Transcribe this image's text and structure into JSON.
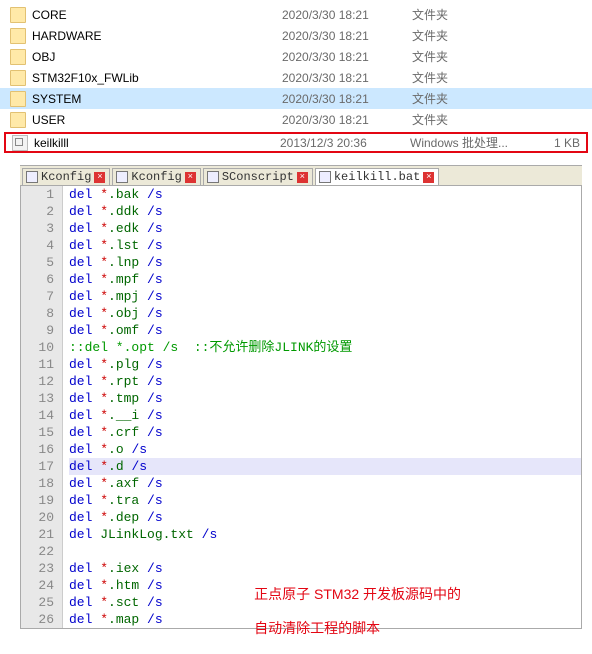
{
  "file_list": [
    {
      "name": "CORE",
      "date": "2020/3/30 18:21",
      "type": "文件夹",
      "size": "",
      "icon": "folder"
    },
    {
      "name": "HARDWARE",
      "date": "2020/3/30 18:21",
      "type": "文件夹",
      "size": "",
      "icon": "folder"
    },
    {
      "name": "OBJ",
      "date": "2020/3/30 18:21",
      "type": "文件夹",
      "size": "",
      "icon": "folder"
    },
    {
      "name": "STM32F10x_FWLib",
      "date": "2020/3/30 18:21",
      "type": "文件夹",
      "size": "",
      "icon": "folder"
    },
    {
      "name": "SYSTEM",
      "date": "2020/3/30 18:21",
      "type": "文件夹",
      "size": "",
      "icon": "folder",
      "selected": true
    },
    {
      "name": "USER",
      "date": "2020/3/30 18:21",
      "type": "文件夹",
      "size": "",
      "icon": "folder"
    },
    {
      "name": "keilkilll",
      "date": "2013/12/3 20:36",
      "type": "Windows 批处理...",
      "size": "1 KB",
      "icon": "bat",
      "boxed": true
    }
  ],
  "tabs": [
    {
      "label": "Kconfig",
      "active": false
    },
    {
      "label": "Kconfig",
      "active": false
    },
    {
      "label": "SConscript",
      "active": false
    },
    {
      "label": "keilkill.bat",
      "active": true
    }
  ],
  "code_lines": [
    {
      "n": 1,
      "tokens": [
        [
          "del ",
          "kw-del"
        ],
        [
          "*",
          "glob"
        ],
        [
          ".bak ",
          "ext"
        ],
        [
          "/s",
          "flag"
        ]
      ]
    },
    {
      "n": 2,
      "tokens": [
        [
          "del ",
          "kw-del"
        ],
        [
          "*",
          "glob"
        ],
        [
          ".ddk ",
          "ext"
        ],
        [
          "/s",
          "flag"
        ]
      ]
    },
    {
      "n": 3,
      "tokens": [
        [
          "del ",
          "kw-del"
        ],
        [
          "*",
          "glob"
        ],
        [
          ".edk ",
          "ext"
        ],
        [
          "/s",
          "flag"
        ]
      ]
    },
    {
      "n": 4,
      "tokens": [
        [
          "del ",
          "kw-del"
        ],
        [
          "*",
          "glob"
        ],
        [
          ".lst ",
          "ext"
        ],
        [
          "/s",
          "flag"
        ]
      ]
    },
    {
      "n": 5,
      "tokens": [
        [
          "del ",
          "kw-del"
        ],
        [
          "*",
          "glob"
        ],
        [
          ".lnp ",
          "ext"
        ],
        [
          "/s",
          "flag"
        ]
      ]
    },
    {
      "n": 6,
      "tokens": [
        [
          "del ",
          "kw-del"
        ],
        [
          "*",
          "glob"
        ],
        [
          ".mpf ",
          "ext"
        ],
        [
          "/s",
          "flag"
        ]
      ]
    },
    {
      "n": 7,
      "tokens": [
        [
          "del ",
          "kw-del"
        ],
        [
          "*",
          "glob"
        ],
        [
          ".mpj ",
          "ext"
        ],
        [
          "/s",
          "flag"
        ]
      ]
    },
    {
      "n": 8,
      "tokens": [
        [
          "del ",
          "kw-del"
        ],
        [
          "*",
          "glob"
        ],
        [
          ".obj ",
          "ext"
        ],
        [
          "/s",
          "flag"
        ]
      ]
    },
    {
      "n": 9,
      "tokens": [
        [
          "del ",
          "kw-del"
        ],
        [
          "*",
          "glob"
        ],
        [
          ".omf ",
          "ext"
        ],
        [
          "/s",
          "flag"
        ]
      ]
    },
    {
      "n": 10,
      "tokens": [
        [
          "::del *.opt /s  ::不允许删除JLINK的设置",
          "comment"
        ]
      ]
    },
    {
      "n": 11,
      "tokens": [
        [
          "del ",
          "kw-del"
        ],
        [
          "*",
          "glob"
        ],
        [
          ".plg ",
          "ext"
        ],
        [
          "/s",
          "flag"
        ]
      ]
    },
    {
      "n": 12,
      "tokens": [
        [
          "del ",
          "kw-del"
        ],
        [
          "*",
          "glob"
        ],
        [
          ".rpt ",
          "ext"
        ],
        [
          "/s",
          "flag"
        ]
      ]
    },
    {
      "n": 13,
      "tokens": [
        [
          "del ",
          "kw-del"
        ],
        [
          "*",
          "glob"
        ],
        [
          ".tmp ",
          "ext"
        ],
        [
          "/s",
          "flag"
        ]
      ]
    },
    {
      "n": 14,
      "tokens": [
        [
          "del ",
          "kw-del"
        ],
        [
          "*",
          "glob"
        ],
        [
          ".__i ",
          "ext"
        ],
        [
          "/s",
          "flag"
        ]
      ]
    },
    {
      "n": 15,
      "tokens": [
        [
          "del ",
          "kw-del"
        ],
        [
          "*",
          "glob"
        ],
        [
          ".crf ",
          "ext"
        ],
        [
          "/s",
          "flag"
        ]
      ]
    },
    {
      "n": 16,
      "tokens": [
        [
          "del ",
          "kw-del"
        ],
        [
          "*",
          "glob"
        ],
        [
          ".o ",
          "ext"
        ],
        [
          "/s",
          "flag"
        ]
      ]
    },
    {
      "n": 17,
      "tokens": [
        [
          "del ",
          "kw-del"
        ],
        [
          "*",
          "glob"
        ],
        [
          ".d ",
          "ext"
        ],
        [
          "/s",
          "flag"
        ]
      ],
      "hl": true
    },
    {
      "n": 18,
      "tokens": [
        [
          "del ",
          "kw-del"
        ],
        [
          "*",
          "glob"
        ],
        [
          ".axf ",
          "ext"
        ],
        [
          "/s",
          "flag"
        ]
      ]
    },
    {
      "n": 19,
      "tokens": [
        [
          "del ",
          "kw-del"
        ],
        [
          "*",
          "glob"
        ],
        [
          ".tra ",
          "ext"
        ],
        [
          "/s",
          "flag"
        ]
      ]
    },
    {
      "n": 20,
      "tokens": [
        [
          "del ",
          "kw-del"
        ],
        [
          "*",
          "glob"
        ],
        [
          ".dep ",
          "ext"
        ],
        [
          "/s",
          "flag"
        ]
      ]
    },
    {
      "n": 21,
      "tokens": [
        [
          "del ",
          "kw-del"
        ],
        [
          "JLinkLog.txt ",
          "ext"
        ],
        [
          "/s",
          "flag"
        ]
      ]
    },
    {
      "n": 22,
      "tokens": [
        [
          "",
          ""
        ]
      ]
    },
    {
      "n": 23,
      "tokens": [
        [
          "del ",
          "kw-del"
        ],
        [
          "*",
          "glob"
        ],
        [
          ".iex ",
          "ext"
        ],
        [
          "/s",
          "flag"
        ]
      ]
    },
    {
      "n": 24,
      "tokens": [
        [
          "del ",
          "kw-del"
        ],
        [
          "*",
          "glob"
        ],
        [
          ".htm ",
          "ext"
        ],
        [
          "/s",
          "flag"
        ]
      ]
    },
    {
      "n": 25,
      "tokens": [
        [
          "del ",
          "kw-del"
        ],
        [
          "*",
          "glob"
        ],
        [
          ".sct ",
          "ext"
        ],
        [
          "/s",
          "flag"
        ]
      ]
    },
    {
      "n": 26,
      "tokens": [
        [
          "del ",
          "kw-del"
        ],
        [
          "*",
          "glob"
        ],
        [
          ".map ",
          "ext"
        ],
        [
          "/s",
          "flag"
        ]
      ]
    }
  ],
  "annotation": {
    "line1": "正点原子 STM32 开发板源码中的",
    "line2": "自动清除工程的脚本"
  },
  "tab_close_glyph": "×"
}
